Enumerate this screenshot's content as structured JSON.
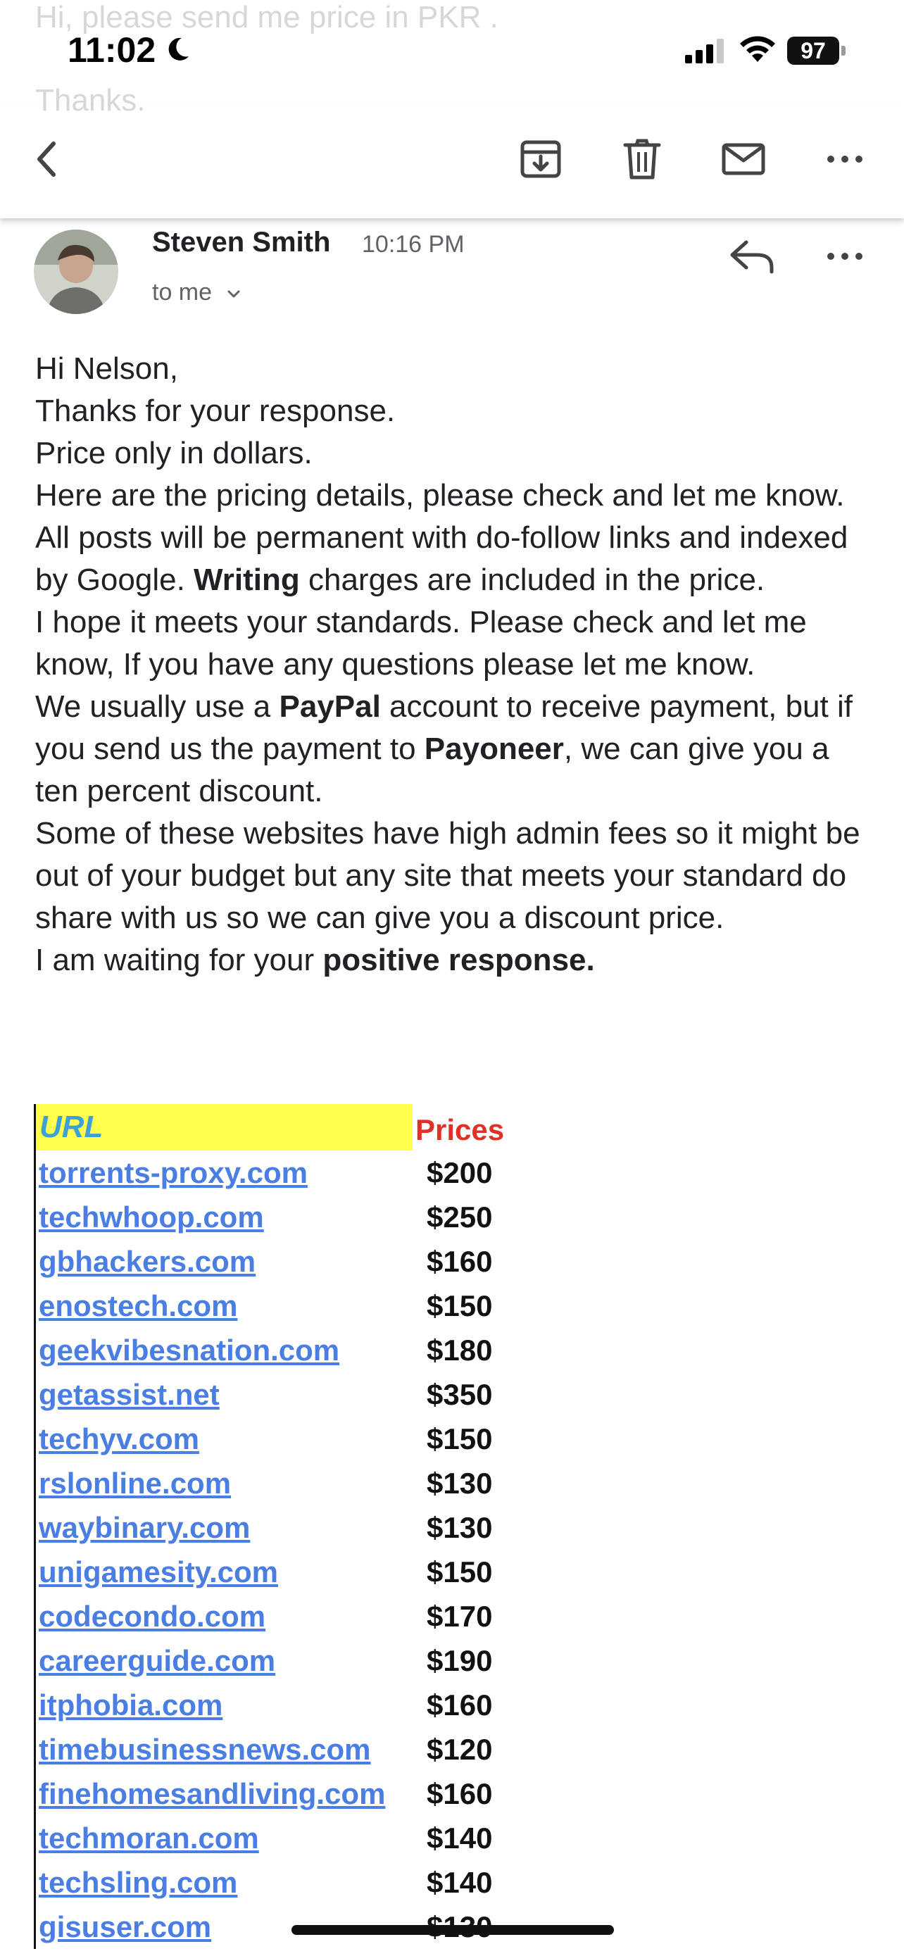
{
  "background_text": {
    "line1": "Hi, please send me price in PKR .",
    "line2": "Thanks."
  },
  "status_bar": {
    "time": "11:02",
    "battery": "97"
  },
  "toolbar": {
    "back": "chevron-left-icon",
    "archive": "archive-icon",
    "delete": "trash-icon",
    "mark_unread": "mail-icon",
    "more": "more-horizontal-icon"
  },
  "message": {
    "sender": "Steven Smith",
    "time": "10:16 PM",
    "recipient": "to me",
    "body": {
      "p1": "Hi Nelson,",
      "p2": "Thanks for your response.",
      "p3": "Price only in dollars.",
      "p4_pre": "Here are the pricing details, please check and let me know. All posts will be permanent with do-follow links and indexed by Google. ",
      "p4_bold": "Writing",
      "p4_post": " charges are included in the price.",
      "p5": "I hope it meets your standards. Please check and let me know, If you have any questions please let me know.",
      "p6_a": "We usually use a ",
      "p6_b": "PayPal",
      "p6_c": " account to receive payment, but if you send us the payment to ",
      "p6_d": "Payoneer",
      "p6_e": ", we can give you a ten percent discount.",
      "p7": "Some of these websites have high admin fees so it might be out of your budget but any site that meets your standard do share with us so we can give you a discount price.",
      "p8_pre": "I am waiting for your ",
      "p8_bold": "positive response."
    }
  },
  "price_table": {
    "header_url": "URL",
    "header_price": "Prices",
    "rows": [
      {
        "url": "torrents-proxy.com",
        "price": "$200"
      },
      {
        "url": "techwhoop.com",
        "price": "$250"
      },
      {
        "url": "gbhackers.com",
        "price": "$160"
      },
      {
        "url": "enostech.com",
        "price": "$150"
      },
      {
        "url": "geekvibesnation.com",
        "price": "$180"
      },
      {
        "url": "getassist.net",
        "price": "$350"
      },
      {
        "url": "techyv.com",
        "price": "$150"
      },
      {
        "url": "rslonline.com",
        "price": "$130"
      },
      {
        "url": "waybinary.com",
        "price": "$130"
      },
      {
        "url": "unigamesity.com",
        "price": "$150"
      },
      {
        "url": "codecondo.com",
        "price": "$170"
      },
      {
        "url": "careerguide.com",
        "price": "$190"
      },
      {
        "url": "itphobia.com",
        "price": "$160"
      },
      {
        "url": "timebusinessnews.com",
        "price": "$120"
      },
      {
        "url": "finehomesandliving.com",
        "price": "$160"
      },
      {
        "url": "techmoran.com",
        "price": "$140"
      },
      {
        "url": "techsling.com",
        "price": "$140"
      },
      {
        "url": "gisuser.com",
        "price": "$130"
      }
    ]
  },
  "colors": {
    "link": "#4a7ee3",
    "header_highlight": "#ffff4d",
    "header_url_text": "#3fa0d6",
    "header_price_text": "#e03127"
  }
}
